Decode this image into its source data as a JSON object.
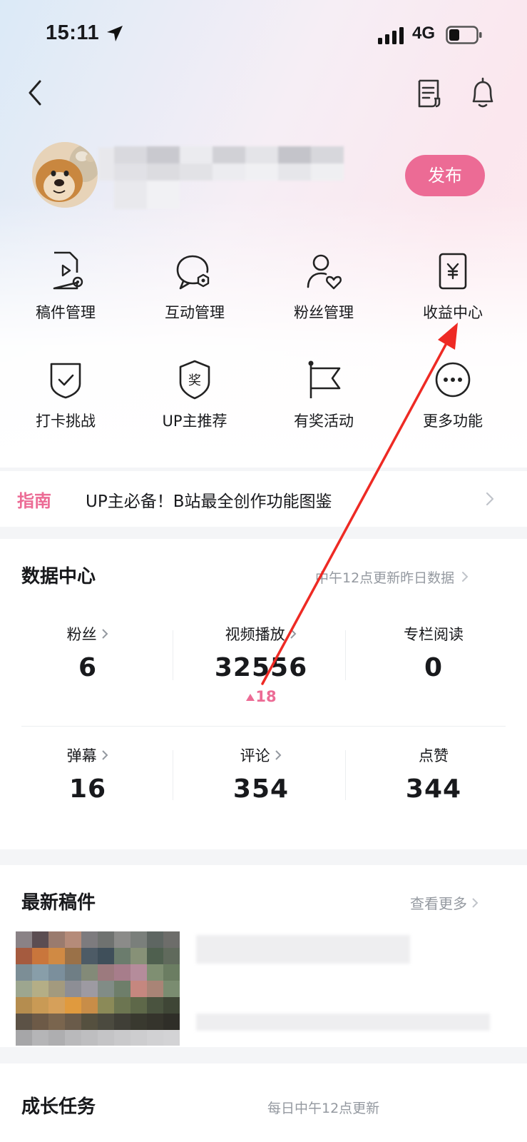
{
  "status_bar": {
    "time": "15:11",
    "network": "4G"
  },
  "profile": {
    "publish_label": "发布"
  },
  "functions": [
    {
      "label": "稿件管理",
      "icon": "manuscript-icon"
    },
    {
      "label": "互动管理",
      "icon": "interaction-icon"
    },
    {
      "label": "粉丝管理",
      "icon": "fans-icon"
    },
    {
      "label": "收益中心",
      "icon": "income-icon"
    },
    {
      "label": "打卡挑战",
      "icon": "checkin-icon"
    },
    {
      "label": "UP主推荐",
      "icon": "award-badge-icon"
    },
    {
      "label": "有奖活动",
      "icon": "flag-icon"
    },
    {
      "label": "更多功能",
      "icon": "more-icon"
    }
  ],
  "guide": {
    "tag": "指南",
    "text": "UP主必备！B站最全创作功能图鉴"
  },
  "data_center": {
    "title": "数据中心",
    "subtitle": "中午12点更新昨日数据",
    "stats": [
      {
        "label": "粉丝",
        "value": "6",
        "has_arrow": true
      },
      {
        "label": "视频播放",
        "value": "32556",
        "delta": "18",
        "has_arrow": true
      },
      {
        "label": "专栏阅读",
        "value": "0",
        "has_arrow": false
      },
      {
        "label": "弹幕",
        "value": "16",
        "has_arrow": true
      },
      {
        "label": "评论",
        "value": "354",
        "has_arrow": true
      },
      {
        "label": "点赞",
        "value": "344",
        "has_arrow": false
      }
    ]
  },
  "latest": {
    "title": "最新稿件",
    "more": "查看更多"
  },
  "growth": {
    "title": "成长任务",
    "subtitle": "每日中午12点更新"
  },
  "colors": {
    "accent": "#ec6b95",
    "annotation_arrow": "#ee2a24"
  }
}
